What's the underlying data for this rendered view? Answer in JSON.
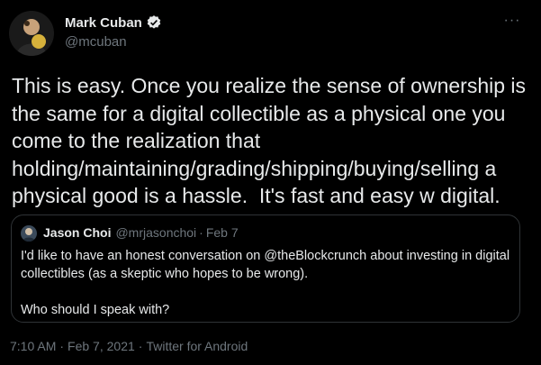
{
  "author": {
    "name": "Mark Cuban",
    "handle": "@mcuban",
    "verified_icon": "verified-badge-icon",
    "avatar_icon": "avatar-photo"
  },
  "more_icon": "more-options-icon",
  "tweet": {
    "text": "This is easy. Once you realize the sense of ownership is the same for a digital collectible as a physical one you come to the realization that holding/maintaining/grading/shipping/buying/selling a physical good is a hassle.  It's fast and easy w digital."
  },
  "quoted": {
    "name": "Jason Choi",
    "handle": "@mrjasonchoi",
    "separator": "·",
    "date": "Feb 7",
    "paragraph1": "I'd like to have an honest conversation on @theBlockcrunch about investing in digital collectibles (as a skeptic who hopes to be wrong).",
    "paragraph2": "Who should I speak with?"
  },
  "meta": {
    "time": "7:10 AM",
    "date": "Feb 7, 2021",
    "source": "Twitter for Android",
    "separator": "·"
  },
  "colors": {
    "background": "#000000",
    "text": "#e7e9ea",
    "secondary": "#6e767d",
    "verified": "#1d9bf0",
    "border": "#2f3336"
  }
}
